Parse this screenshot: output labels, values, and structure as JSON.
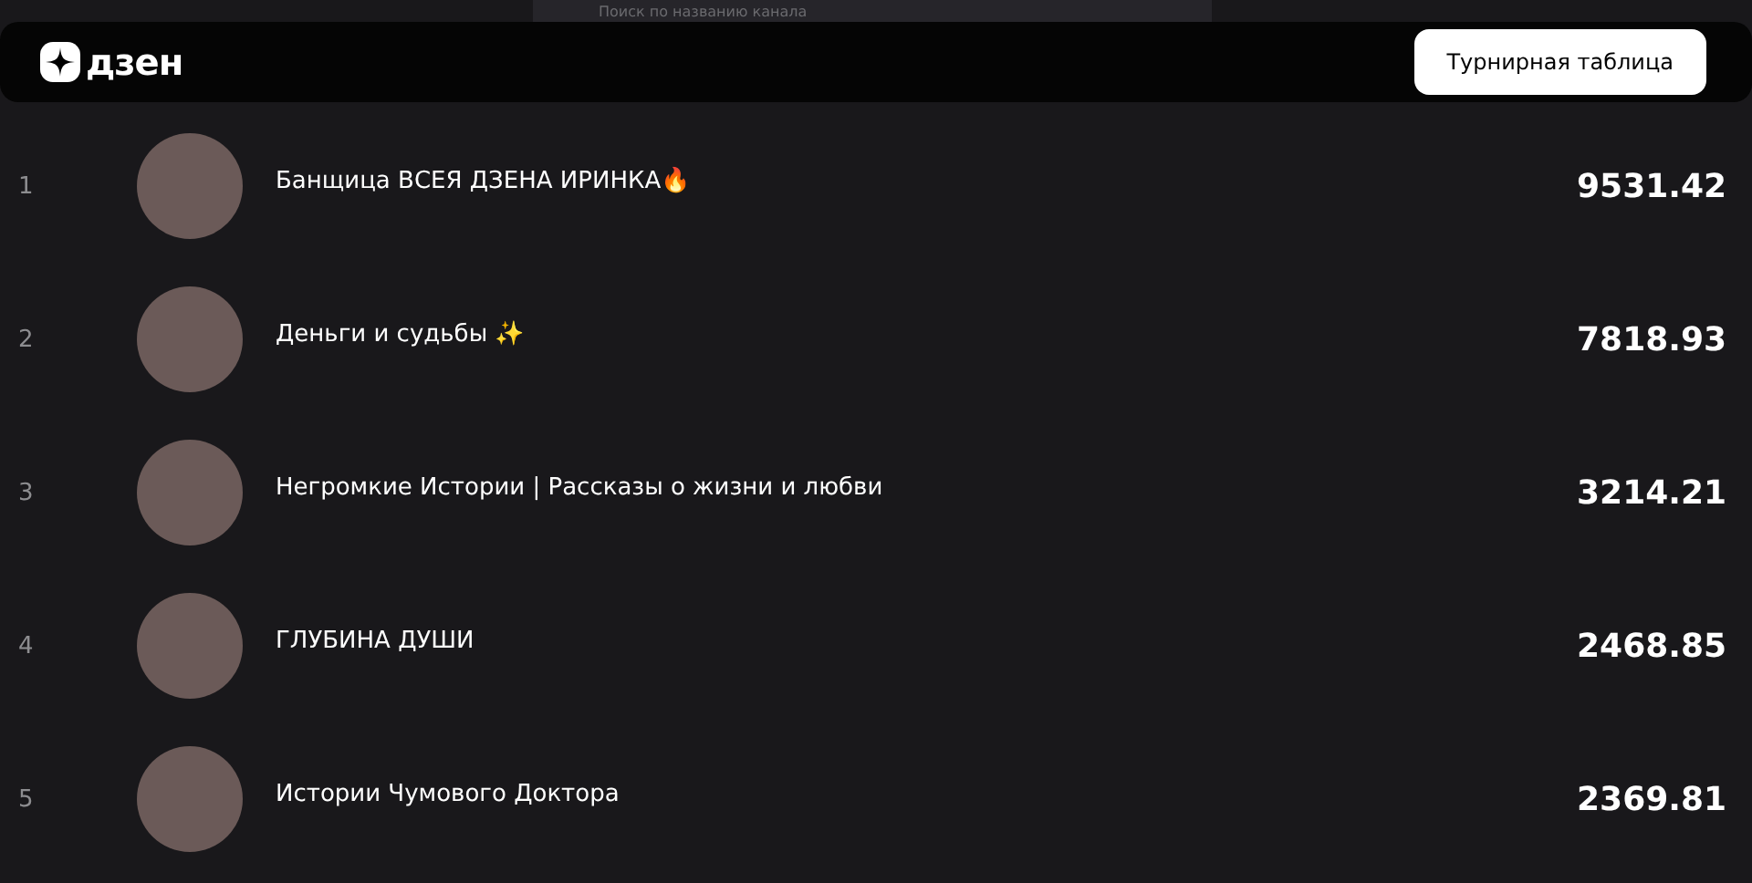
{
  "search": {
    "placeholder": "Поиск по названию канала"
  },
  "header": {
    "logo": "дзен",
    "button": "Турнирная таблица"
  },
  "rows": [
    {
      "rank": "1",
      "name": "Банщица ВСЕЯ ДЗЕНА ИРИНКА🔥",
      "score": "9531.42"
    },
    {
      "rank": "2",
      "name": "Деньги и судьбы ✨",
      "score": "7818.93"
    },
    {
      "rank": "3",
      "name": "Негромкие Истории | Рассказы о жизни и любви",
      "score": "3214.21"
    },
    {
      "rank": "4",
      "name": "ГЛУБИНА ДУШИ",
      "score": "2468.85"
    },
    {
      "rank": "5",
      "name": "Истории Чумового Доктора",
      "score": "2369.81"
    }
  ]
}
